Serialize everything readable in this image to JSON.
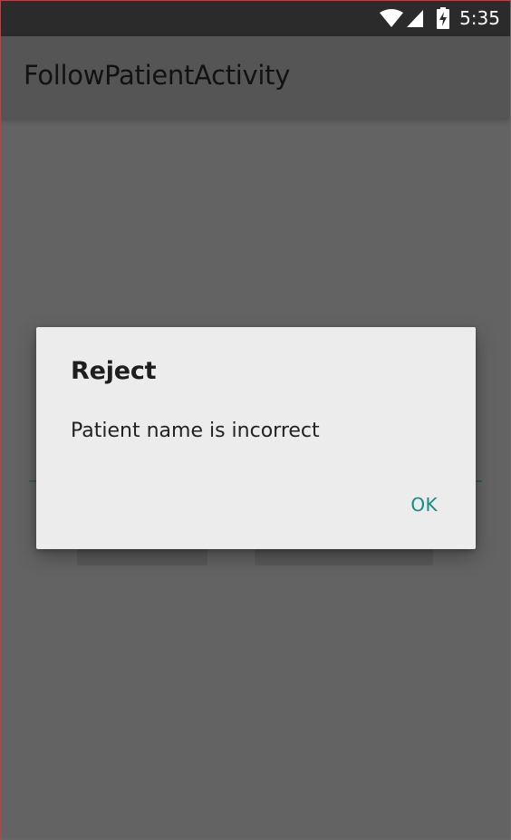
{
  "status_bar": {
    "time": "5:35",
    "icons": [
      "wifi-icon",
      "signal-icon",
      "battery-charging-icon"
    ]
  },
  "app_bar": {
    "title": "FollowPatientActivity"
  },
  "dialog": {
    "title": "Reject",
    "message": "Patient name is incorrect",
    "ok_label": "OK"
  },
  "colors": {
    "status_bar_bg": "#2b2b2b",
    "scrim_bg": "#636363",
    "dialog_bg": "#ececec",
    "accent": "#0f8f85"
  }
}
